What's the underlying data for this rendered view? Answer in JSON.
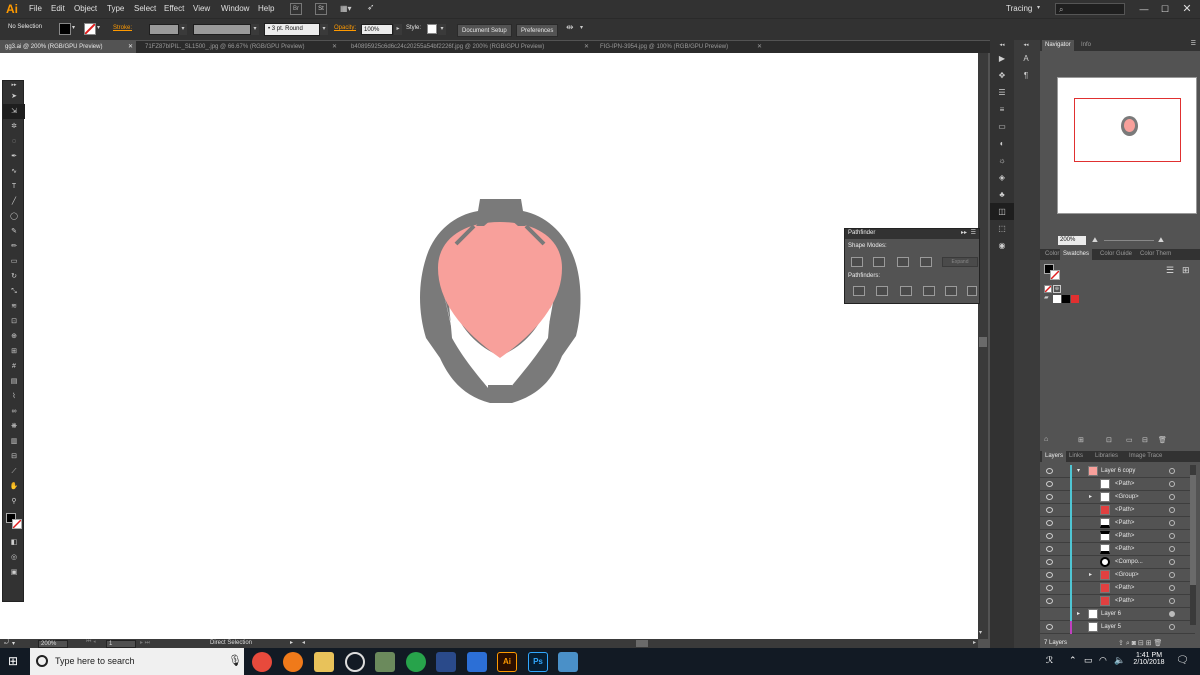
{
  "app": {
    "logo": "Ai",
    "workspace": "Tracing"
  },
  "menu": [
    "File",
    "Edit",
    "Object",
    "Type",
    "Select",
    "Effect",
    "View",
    "Window",
    "Help"
  ],
  "control_bar": {
    "selection_status": "No Selection",
    "stroke_label": "Stroke:",
    "brush_label": "3 pt. Round",
    "opacity_label": "Opacity:",
    "opacity_value": "100%",
    "style_label": "Style:",
    "document_setup": "Document Setup",
    "preferences": "Preferences"
  },
  "tabs": [
    {
      "label": "gg3.ai @ 200% (RGB/GPU Preview)",
      "active": true
    },
    {
      "label": "71FZ87bIPIL._SL1500_.jpg @ 66.67% (RGB/GPU Preview)",
      "active": false
    },
    {
      "label": "b40895925c6d6c24c20255a54bf2226f.jpg @ 200% (RGB/GPU Preview)",
      "active": false
    },
    {
      "label": "FIG-IPN-3954.jpg @ 100% (RGB/GPU Preview)",
      "active": false
    }
  ],
  "status": {
    "zoom": "200%",
    "artboard": "1",
    "tool": "Direct Selection"
  },
  "pathfinder": {
    "title": "Pathfinder",
    "shape_modes": "Shape Modes:",
    "pathfinders": "Pathfinders:",
    "expand": "Expand"
  },
  "navigator": {
    "tab": "Navigator",
    "tab2": "Info",
    "zoom": "200%"
  },
  "swatches": {
    "tabs": [
      "Color",
      "Swatches",
      "Color Guide",
      "Color Them"
    ],
    "active": "Swatches"
  },
  "layers": {
    "tabs": [
      "Layers",
      "Links",
      "Libraries",
      "Image Trace"
    ],
    "rows": [
      {
        "name": "Layer 6 copy",
        "indent": 0,
        "expanded": true
      },
      {
        "name": "<Path>",
        "indent": 1
      },
      {
        "name": "<Group>",
        "indent": 1,
        "collapsed": true
      },
      {
        "name": "<Path>",
        "indent": 1
      },
      {
        "name": "<Path>",
        "indent": 1
      },
      {
        "name": "<Path>",
        "indent": 1
      },
      {
        "name": "<Path>",
        "indent": 1
      },
      {
        "name": "<Compo...",
        "indent": 1
      },
      {
        "name": "<Group>",
        "indent": 1,
        "collapsed": true
      },
      {
        "name": "<Path>",
        "indent": 1
      },
      {
        "name": "<Path>",
        "indent": 1
      },
      {
        "name": "Layer 6",
        "indent": 0,
        "collapsed": true
      },
      {
        "name": "Layer 5",
        "indent": 0
      }
    ],
    "count": "7 Layers"
  },
  "taskbar": {
    "search_placeholder": "Type here to search",
    "time": "1:41 PM",
    "date": "2/10/2018"
  },
  "colors": {
    "accent": "#ff9a00",
    "helmet_gray": "#7a7a7a",
    "visor_pink": "#f8a09b",
    "selection_red": "#e03030"
  }
}
